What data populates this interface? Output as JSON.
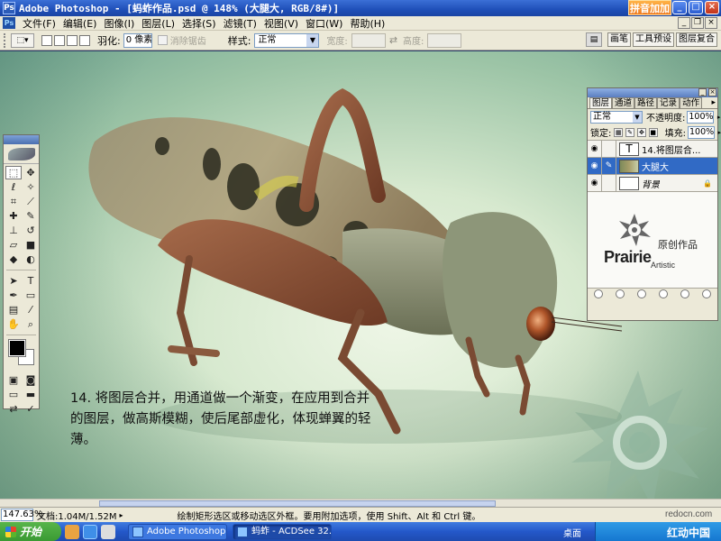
{
  "window": {
    "title": "Adobe Photoshop - [蚂蚱作品.psd @ 148% (大腿大, RGB/8#)]",
    "app_icon_label": "Ps",
    "badge": "拼音加加"
  },
  "menubar": {
    "items": [
      "文件(F)",
      "编辑(E)",
      "图像(I)",
      "图层(L)",
      "选择(S)",
      "滤镜(T)",
      "视图(V)",
      "窗口(W)",
      "帮助(H)"
    ]
  },
  "options": {
    "feather_label": "羽化:",
    "feather_value": "0 像素",
    "antialias_label": "消除锯齿",
    "style_label": "样式:",
    "style_value": "正常",
    "width_label": "宽度:",
    "height_label": "高度:",
    "palette_tabs": [
      "画笔",
      "工具预设",
      "图层复合"
    ]
  },
  "canvas": {
    "caption": "14. 将图层合并，用通道做一个渐变，在应用到合并的图层，做高斯模糊，使后尾部虚化，体现蝉翼的轻薄。"
  },
  "layers_panel": {
    "tabs": [
      "图层",
      "通道",
      "路径",
      "记录",
      "动作"
    ],
    "blend_mode": "正常",
    "opacity_label": "不透明度:",
    "opacity_value": "100%",
    "lock_label": "锁定:",
    "fill_label": "填充:",
    "fill_value": "100%",
    "layers": [
      {
        "name": "14.将图层合...",
        "thumb": "T",
        "selected": false
      },
      {
        "name": "大腿大",
        "thumb": "",
        "selected": true
      },
      {
        "name": "背景",
        "thumb": "",
        "selected": false
      }
    ],
    "logo": {
      "brand": "Prairie",
      "sub": "Artistic",
      "cn": "原创作品"
    }
  },
  "status": {
    "zoom": "147.63%",
    "doc_size": "文档:1.04M/1.52M",
    "hint": "绘制矩形选区或移动选区外框。要用附加选项，使用 Shift、Alt 和 Ctrl 键。"
  },
  "taskbar": {
    "start": "开始",
    "tasks": [
      "Adobe Photoshop ...",
      "蚂蚱 - ACDSee 32..."
    ],
    "desktop_label": "桌面",
    "watermark_site": "redocn.com",
    "watermark_name": "红动中国"
  },
  "colors": {
    "titlebar": "#1f4fb8",
    "selection": "#316ac5",
    "foreground": "#000000",
    "background": "#ffffff"
  }
}
